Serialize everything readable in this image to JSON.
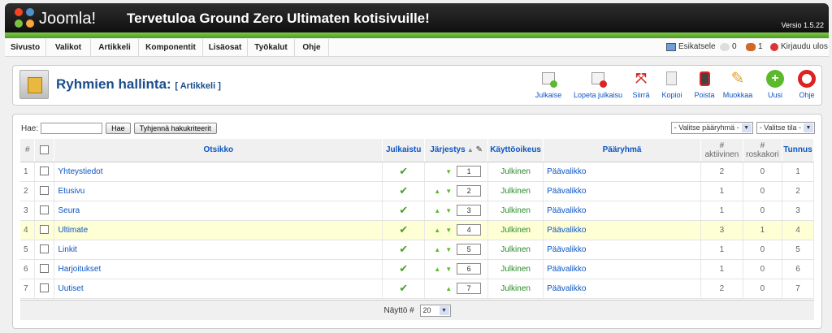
{
  "header": {
    "logo_text": "Joomla!",
    "site_title": "Tervetuloa Ground Zero Ultimaten kotisivuille!",
    "version": "Versio 1.5.22"
  },
  "menu": [
    "Sivusto",
    "Valikot",
    "Artikkeli",
    "Komponentit",
    "Lisäosat",
    "Työkalut",
    "Ohje"
  ],
  "status": {
    "preview": "Esikatsele",
    "messages": "0",
    "users": "1",
    "logout": "Kirjaudu ulos"
  },
  "page": {
    "title": "Ryhmien hallinta:",
    "subtitle": "[ Artikkeli ]"
  },
  "toolbar": [
    {
      "name": "publish",
      "label": "Julkaise"
    },
    {
      "name": "unpublish",
      "label": "Lopeta julkaisu"
    },
    {
      "name": "move",
      "label": "Siirrä"
    },
    {
      "name": "copy",
      "label": "Kopioi"
    },
    {
      "name": "delete",
      "label": "Poista"
    },
    {
      "name": "edit",
      "label": "Muokkaa"
    },
    {
      "name": "new",
      "label": "Uusi"
    },
    {
      "name": "help",
      "label": "Ohje"
    }
  ],
  "filter": {
    "label": "Hae:",
    "value": "",
    "search_btn": "Hae",
    "reset_btn": "Tyhjennä hakukriteerit",
    "parent_select": "- Valitse pääryhmä -",
    "state_select": "- Valitse tila -"
  },
  "columns": {
    "num": "#",
    "title": "Otsikko",
    "published": "Julkaistu",
    "order": "Järjestys",
    "access": "Käyttöoikeus",
    "parent": "Pääryhmä",
    "active_hash": "#",
    "active": "aktiivinen",
    "trash_hash": "#",
    "trash": "roskakori",
    "id": "Tunnus"
  },
  "rows": [
    {
      "num": "1",
      "title": "Yhteystiedot",
      "order": "1",
      "access": "Julkinen",
      "parent": "Päävalikko",
      "active": "2",
      "trash": "0",
      "id": "1"
    },
    {
      "num": "2",
      "title": "Etusivu",
      "order": "2",
      "access": "Julkinen",
      "parent": "Päävalikko",
      "active": "1",
      "trash": "0",
      "id": "2"
    },
    {
      "num": "3",
      "title": "Seura",
      "order": "3",
      "access": "Julkinen",
      "parent": "Päävalikko",
      "active": "1",
      "trash": "0",
      "id": "3"
    },
    {
      "num": "4",
      "title": "Ultimate",
      "order": "4",
      "access": "Julkinen",
      "parent": "Päävalikko",
      "active": "3",
      "trash": "1",
      "id": "4"
    },
    {
      "num": "5",
      "title": "Linkit",
      "order": "5",
      "access": "Julkinen",
      "parent": "Päävalikko",
      "active": "1",
      "trash": "0",
      "id": "5"
    },
    {
      "num": "6",
      "title": "Harjoitukset",
      "order": "6",
      "access": "Julkinen",
      "parent": "Päävalikko",
      "active": "1",
      "trash": "0",
      "id": "6"
    },
    {
      "num": "7",
      "title": "Uutiset",
      "order": "7",
      "access": "Julkinen",
      "parent": "Päävalikko",
      "active": "2",
      "trash": "0",
      "id": "7"
    }
  ],
  "footer": {
    "display_label": "Näyttö #",
    "display_value": "20"
  },
  "colors": {
    "accent_blue": "#0b55c4",
    "header_green": "#5ca92a",
    "highlight_row": "#ffffd6"
  }
}
